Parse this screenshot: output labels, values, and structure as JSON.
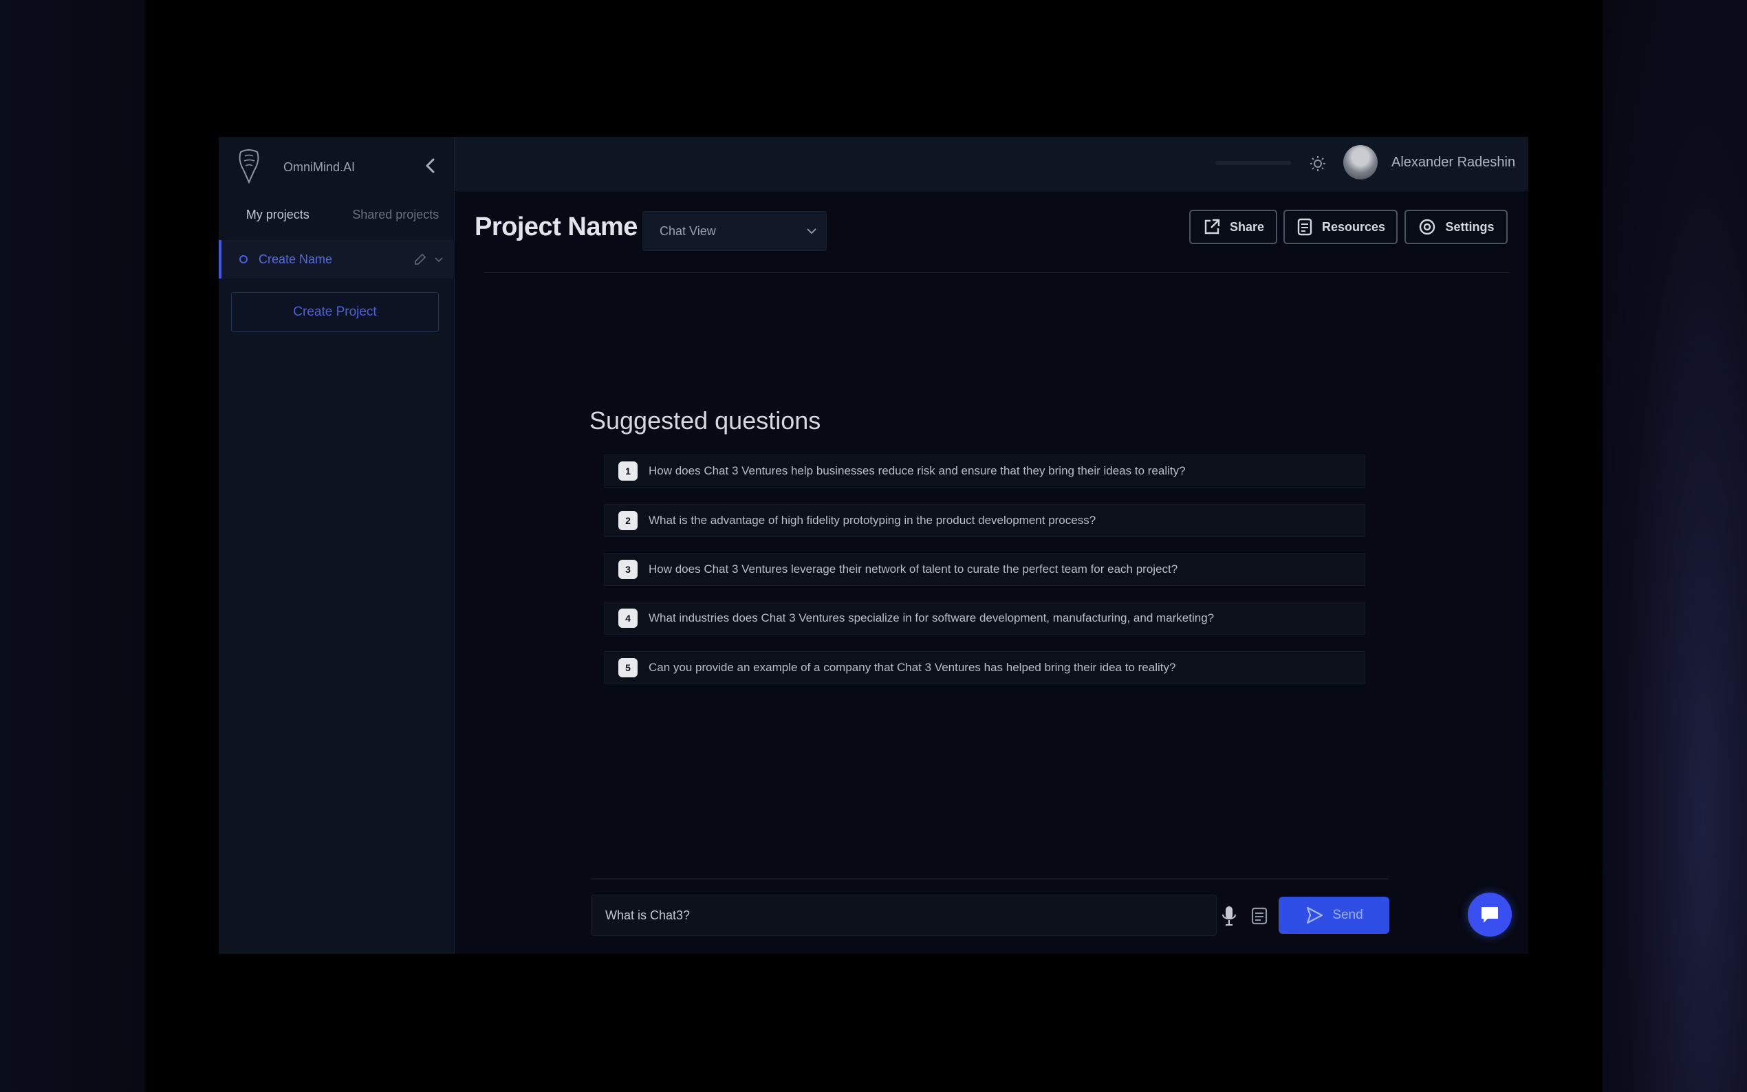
{
  "app": {
    "name": "OmniMind.AI"
  },
  "sidebar": {
    "tabs": [
      "My projects",
      "Shared projects"
    ],
    "project_item": "Create Name",
    "create_button": "Create Project"
  },
  "topbar": {
    "username": "Alexander Radeshin"
  },
  "header": {
    "project_name": "Project Name",
    "view_select": "Chat View",
    "buttons": {
      "share": "Share",
      "resources": "Resources",
      "settings": "Settings"
    }
  },
  "suggested": {
    "title": "Suggested questions",
    "questions": [
      {
        "num": "1",
        "text": "How does Chat 3 Ventures help businesses reduce risk and ensure that they bring their ideas to reality?"
      },
      {
        "num": "2",
        "text": "What is the advantage of high fidelity prototyping in the product development process?"
      },
      {
        "num": "3",
        "text": "How does Chat 3 Ventures leverage their network of talent to curate the perfect team for each project?"
      },
      {
        "num": "4",
        "text": "What industries does Chat 3 Ventures specialize in for software development, manufacturing, and marketing?"
      },
      {
        "num": "5",
        "text": "Can you provide an example of a company that Chat 3 Ventures has helped bring their idea to reality?"
      }
    ]
  },
  "chat": {
    "input_value": "What is Chat3?",
    "send_label": "Send"
  },
  "colors": {
    "accent": "#2f4ee6",
    "background": "#070a14",
    "sidebar": "#0d131f"
  }
}
